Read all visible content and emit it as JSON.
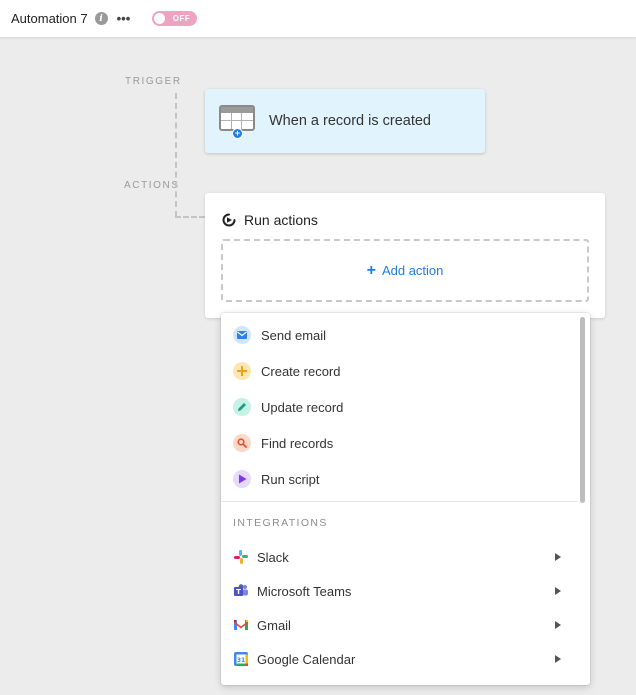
{
  "header": {
    "title": "Automation 7",
    "toggle_label": "OFF"
  },
  "canvas": {
    "trigger_label": "TRIGGER",
    "actions_label": "ACTIONS"
  },
  "trigger": {
    "text": "When a record is created",
    "icon": "table-icon"
  },
  "actions": {
    "title": "Run actions",
    "add_label": "Add action"
  },
  "dropdown": {
    "items": [
      {
        "label": "Send email",
        "icon": "mail-icon",
        "color": "#2d7ff9",
        "bg": "#d3e5fd"
      },
      {
        "label": "Create record",
        "icon": "plus-icon",
        "color": "#f0a21b",
        "bg": "#fde6b1"
      },
      {
        "label": "Update record",
        "icon": "pencil-icon",
        "color": "#1d9b86",
        "bg": "#c6f2e6"
      },
      {
        "label": "Find records",
        "icon": "search-icon",
        "color": "#e2512a",
        "bg": "#fcd8ca"
      },
      {
        "label": "Run script",
        "icon": "play-icon",
        "color": "#7c39ed",
        "bg": "#e6d9fb"
      }
    ],
    "section_label": "INTEGRATIONS",
    "integrations": [
      {
        "label": "Slack",
        "icon": "slack-icon"
      },
      {
        "label": "Microsoft Teams",
        "icon": "teams-icon"
      },
      {
        "label": "Gmail",
        "icon": "gmail-icon"
      },
      {
        "label": "Google Calendar",
        "icon": "google-calendar-icon"
      }
    ]
  }
}
